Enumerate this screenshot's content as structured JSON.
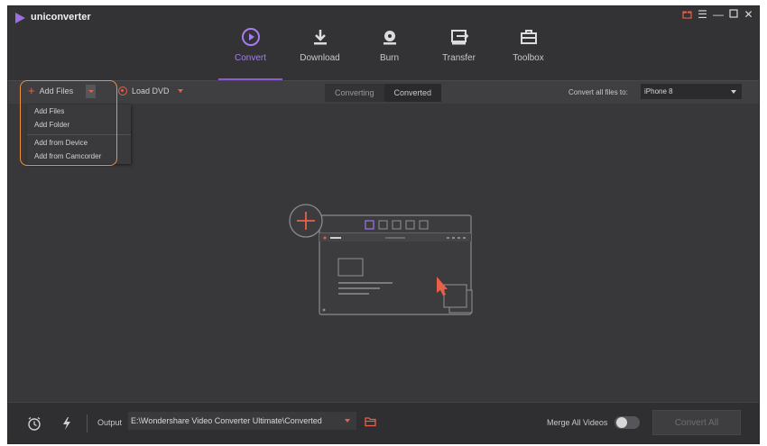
{
  "app": {
    "title": "uniconverter"
  },
  "nav": {
    "items": [
      {
        "label": "Convert",
        "icon": "convert-icon",
        "active": true
      },
      {
        "label": "Download",
        "icon": "download-icon"
      },
      {
        "label": "Burn",
        "icon": "burn-icon"
      },
      {
        "label": "Transfer",
        "icon": "transfer-icon"
      },
      {
        "label": "Toolbox",
        "icon": "toolbox-icon"
      }
    ]
  },
  "toolbar": {
    "add_files_label": "Add Files",
    "load_dvd_label": "Load DVD",
    "tabs": [
      "Converting",
      "Converted"
    ],
    "convert_all_label": "Convert all files to:",
    "target_format": "iPhone 8"
  },
  "add_menu": {
    "items": [
      "Add Files",
      "Add Folder",
      "Add from Device",
      "Add from Camcorder"
    ]
  },
  "bottom": {
    "output_label": "Output",
    "output_path": "E:\\Wondershare Video Converter Ultimate\\Converted",
    "merge_label": "Merge All Videos",
    "merge_enabled": false,
    "convert_all_button": "Convert All"
  },
  "colors": {
    "accent": "#8c5ad9",
    "orange": "#e8604a",
    "highlight": "#f0903a",
    "background": "#38383a"
  }
}
